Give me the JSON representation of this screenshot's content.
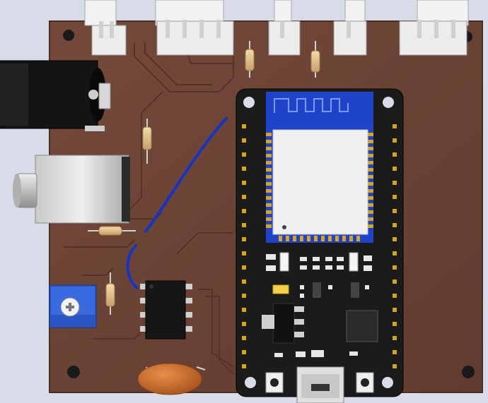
{
  "scene": {
    "kind": "pcb-3d-render",
    "colors": {
      "background": "#d8dce8",
      "board": "#6b4436",
      "board_edge": "#4a2c22",
      "trace": "#5a3428",
      "module": "#1b1b1b",
      "esp_antenna": "#1f44c9",
      "shield": "#f0f0f2",
      "gold": "#d8a41c",
      "jumper": "#1434c8",
      "pot": "#2f66d6",
      "capacitor": "#c86c28",
      "connector": "#e8e8e8"
    },
    "components": [
      "top-connector-1",
      "top-connector-2",
      "top-connector-3",
      "top-connector-4",
      "top-connector-5",
      "dc-barrel-jack",
      "audio-jack",
      "resistor-r1",
      "resistor-r2",
      "resistor-r3",
      "resistor-r4",
      "resistor-r5",
      "blue-jumper-wire",
      "trimmer-potentiometer",
      "ic-dip8",
      "ceramic-capacitor",
      "esp32-devkit",
      "usb-port"
    ]
  }
}
